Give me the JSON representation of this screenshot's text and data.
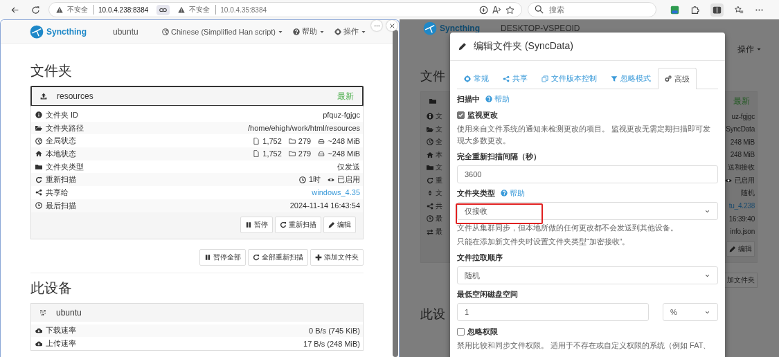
{
  "browser": {
    "address_bar": {
      "panes": [
        {
          "security": "不安全",
          "url": "10.0.4.238:8384"
        },
        {
          "security": "不安全",
          "url": "10.0.4.35:8384"
        }
      ]
    },
    "search": {
      "placeholder": "搜索"
    }
  },
  "left_pane": {
    "navbar": {
      "brand": "Syncthing",
      "device": "ubuntu",
      "menus": [
        "Chinese (Simplified Han script)",
        "帮助",
        "操作"
      ]
    },
    "folders_heading": "文件夹",
    "folder": {
      "name": "resources",
      "status": "最新",
      "rows": [
        {
          "kind": "text",
          "label": "文件夹 ID",
          "value": "pfquz-fgjgc"
        },
        {
          "kind": "text",
          "label": "文件夹路径",
          "value": "/home/ehigh/work/html/resources"
        },
        {
          "kind": "stats",
          "label": "全局状态",
          "files": "1,752",
          "dirs": "279",
          "size": "~248 MiB"
        },
        {
          "kind": "stats",
          "label": "本地状态",
          "files": "1,752",
          "dirs": "279",
          "size": "~248 MiB"
        },
        {
          "kind": "text",
          "label": "文件夹类型",
          "value": "仅发送"
        },
        {
          "kind": "rescan",
          "label": "重新扫描",
          "interval": "1时",
          "watcher": "已启用"
        },
        {
          "kind": "link",
          "label": "共享给",
          "value": "windows_4.35"
        },
        {
          "kind": "text",
          "label": "最后扫描",
          "value": "2024-11-14 16:43:54"
        }
      ],
      "buttons": [
        "暂停",
        "重新扫描",
        "编辑"
      ]
    },
    "global_buttons": [
      "暂停全部",
      "全部重新扫描",
      "添加文件夹"
    ],
    "device_heading": "此设备",
    "device": {
      "name": "ubuntu",
      "rows": [
        {
          "label": "下载速率",
          "value": "0 B/s (745 KiB)"
        },
        {
          "label": "上传速率",
          "value": "17 B/s (248 MiB)"
        }
      ]
    }
  },
  "right_pane": {
    "backdrop": {
      "brand": "Syncthing",
      "device": "DESKTOP-VSPEOID",
      "menu": "操作",
      "heading": "文件",
      "folder_status": "最新",
      "rows": [
        {
          "label": "文",
          "value": "uz-fgjgc",
          "kind": "text"
        },
        {
          "label": "文",
          "value": "SyncData",
          "kind": "text"
        },
        {
          "label": "全",
          "value": "248 MiB",
          "kind": "text"
        },
        {
          "label": "本",
          "value": "248 MiB",
          "kind": "text"
        },
        {
          "label": "文",
          "value": "送和接收",
          "kind": "text"
        },
        {
          "label": "重",
          "value": "已启用",
          "kind": "watch"
        },
        {
          "label": "文",
          "value": "随机",
          "kind": "text"
        },
        {
          "label": "共",
          "value": "tu_4.238",
          "kind": "link"
        },
        {
          "label": "最",
          "value": "16:39:40",
          "kind": "text"
        },
        {
          "label": "最",
          "value": "info.json",
          "kind": "text"
        }
      ],
      "button": "编辑",
      "global_button": "加文件夹",
      "device_heading": "此设"
    },
    "modal": {
      "title": "编辑文件夹 (SyncData)",
      "tabs": [
        {
          "label": "常规",
          "selected": false
        },
        {
          "label": "共享",
          "selected": false
        },
        {
          "label": "文件版本控制",
          "selected": false
        },
        {
          "label": "忽略模式",
          "selected": false
        },
        {
          "label": "高级",
          "selected": true
        }
      ],
      "fields": [
        {
          "kind": "label",
          "label": "扫描中",
          "help": "帮助"
        },
        {
          "kind": "checkbox",
          "label": "监视更改",
          "checked": true
        },
        {
          "kind": "hint",
          "text": "使用来自文件系统的通知来检测更改的项目。 监视更改无需定期扫描即可发现大多数更改。"
        },
        {
          "kind": "label",
          "label": "完全重新扫描间隔（秒）"
        },
        {
          "kind": "input",
          "value": "3600"
        },
        {
          "kind": "label",
          "label": "文件夹类型",
          "help": "帮助"
        },
        {
          "kind": "select",
          "value": "仅接收",
          "highlighted": true
        },
        {
          "kind": "hint",
          "text": "文件从集群同步，但本地所做的任何更改都不会发送到其他设备。"
        },
        {
          "kind": "hint",
          "text": "只能在添加新文件夹时设置文件夹类型“加密接收”。"
        },
        {
          "kind": "label",
          "label": "文件拉取顺序"
        },
        {
          "kind": "select",
          "value": "随机",
          "highlighted": false
        },
        {
          "kind": "label",
          "label": "最低空闲磁盘空间"
        },
        {
          "kind": "input_unit",
          "value": "1",
          "unit": "%"
        },
        {
          "kind": "checkbox",
          "label": "忽略权限",
          "checked": false
        },
        {
          "kind": "hint",
          "text": "禁用比较和同步文件权限。 适用于不存在或自定义权限的系统（例如 FAT、"
        }
      ]
    }
  }
}
